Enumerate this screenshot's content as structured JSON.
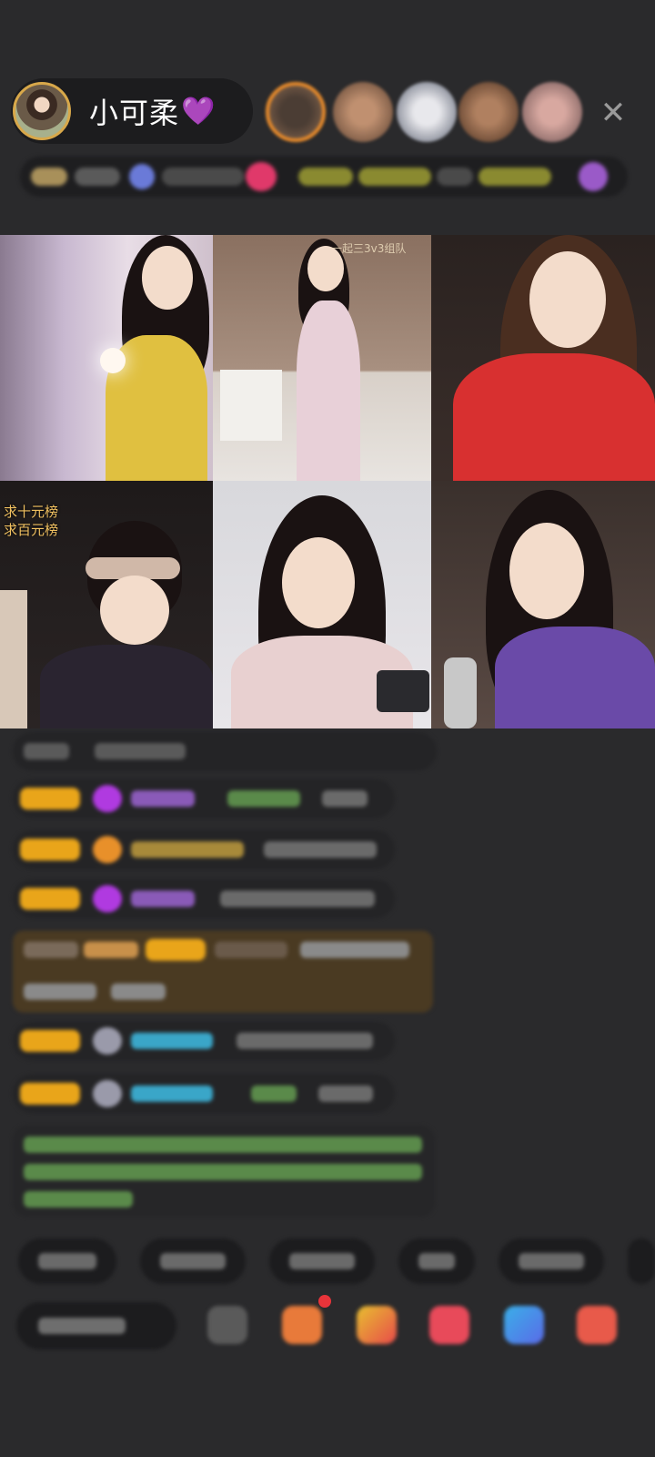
{
  "host": {
    "name": "小可柔",
    "heart": "💜"
  },
  "header": {
    "close_label": "✕"
  },
  "grid": {
    "tile4_label_line1": "求十元榜",
    "tile4_label_line2": "求百元榜",
    "tile2_watermark": "一起三3v3组队"
  },
  "colors": {
    "background": "#2a2a2c",
    "badge": "#e9a51a",
    "accent_purple": "#a05cf0",
    "chat_green": "#7bc86b",
    "chat_cyan": "#3aa6c8"
  }
}
